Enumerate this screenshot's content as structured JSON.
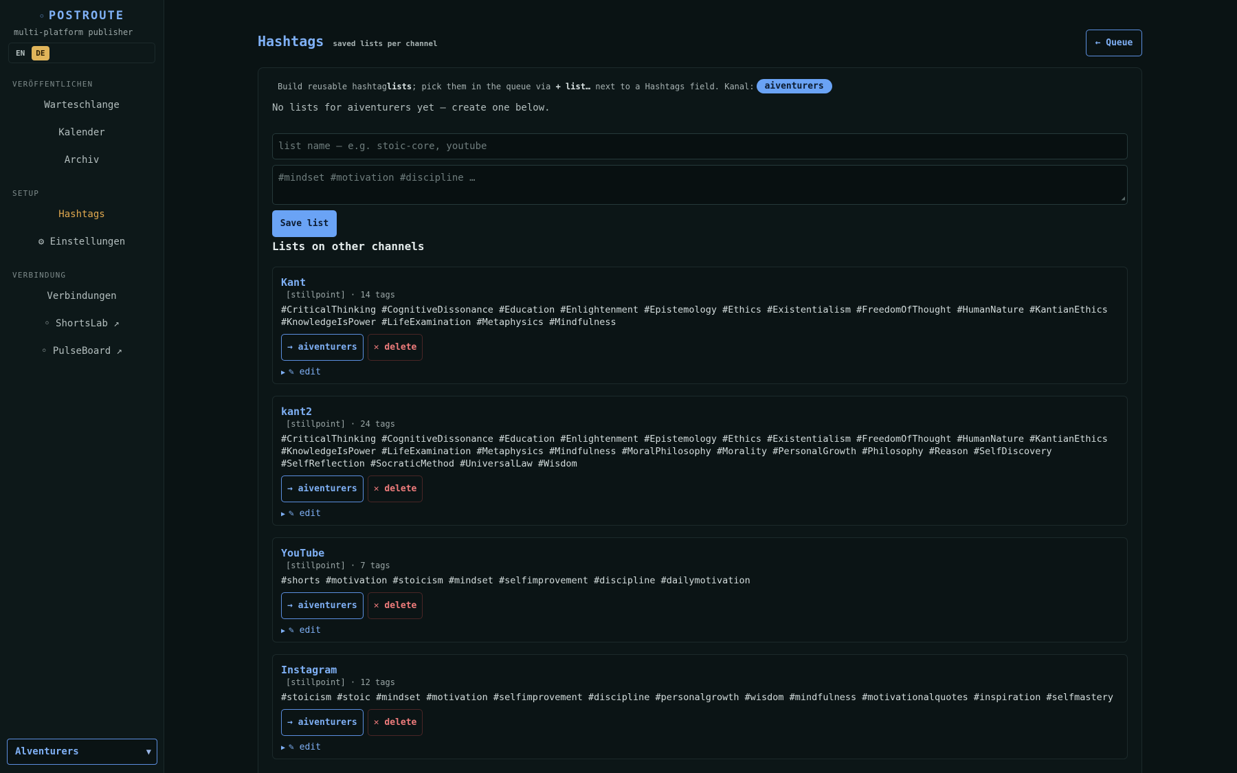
{
  "sidebar": {
    "brand_dot": "◦",
    "brand": "POSTROUTE",
    "subtitle": "multi-platform publisher",
    "lang": [
      "EN",
      "DE"
    ],
    "sections": {
      "publish": "VERÖFFENTLICHEN",
      "setup": "SETUP",
      "connection": "VERBINDUNG"
    },
    "items": {
      "queue": "Warteschlange",
      "calendar": "Kalender",
      "archive": "Archiv",
      "hashtags": "Hashtags",
      "settings": "⚙ Einstellungen",
      "connections": "Verbindungen",
      "shortslab": "◦ ShortsLab ↗",
      "pulseboard": "◦ PulseBoard ↗"
    },
    "channel_select": "Alventurers"
  },
  "header": {
    "title": "Hashtags",
    "subtitle": "saved lists per channel",
    "queue_button": "← Queue"
  },
  "intro": {
    "part1": "Build reusable hashtag ",
    "bold1": "lists",
    "part2": "; pick them in the queue via ",
    "bold2": "+ list…",
    "part3": " next to a Hashtags field. Kanal:",
    "channel": "aiventurers"
  },
  "empty_message": "No lists for aiventurers yet — create one below.",
  "form": {
    "name_placeholder": "list name — e.g. stoic-core, youtube",
    "tags_placeholder": "#mindset #motivation #discipline …",
    "save_label": "Save list"
  },
  "lists_heading": "Lists on other channels",
  "lists": [
    {
      "name": "Kant",
      "meta": "[stillpoint] · 14 tags",
      "tags": "#CriticalThinking #CognitiveDissonance #Education #Enlightenment #Epistemology #Ethics #Existentialism #FreedomOfThought #HumanNature #KantianEthics #KnowledgeIsPower #LifeExamination #Metaphysics #Mindfulness",
      "assign": "→ aiventurers",
      "delete": "✕ delete",
      "edit": "✎ edit"
    },
    {
      "name": "kant2",
      "meta": "[stillpoint] · 24 tags",
      "tags": "#CriticalThinking #CognitiveDissonance #Education #Enlightenment #Epistemology #Ethics #Existentialism #FreedomOfThought #HumanNature #KantianEthics #KnowledgeIsPower #LifeExamination #Metaphysics #Mindfulness #MoralPhilosophy #Morality #PersonalGrowth #Philosophy #Reason #SelfDiscovery #SelfReflection #SocraticMethod #UniversalLaw #Wisdom",
      "assign": "→ aiventurers",
      "delete": "✕ delete",
      "edit": "✎ edit"
    },
    {
      "name": "YouTube",
      "meta": "[stillpoint] · 7 tags",
      "tags": "#shorts #motivation #stoicism #mindset #selfimprovement #discipline #dailymotivation",
      "assign": "→ aiventurers",
      "delete": "✕ delete",
      "edit": "✎ edit"
    },
    {
      "name": "Instagram",
      "meta": "[stillpoint] · 12 tags",
      "tags": "#stoicism #stoic #mindset #motivation #selfimprovement #discipline #personalgrowth #wisdom #mindfulness #motivationalquotes #inspiration #selfmastery",
      "assign": "→ aiventurers",
      "delete": "✕ delete",
      "edit": "✎ edit"
    }
  ],
  "colors": {
    "accent": "#6aa3f5",
    "active_nav": "#e0a84f",
    "danger": "#ef7c7c",
    "background": "#0a1314"
  }
}
